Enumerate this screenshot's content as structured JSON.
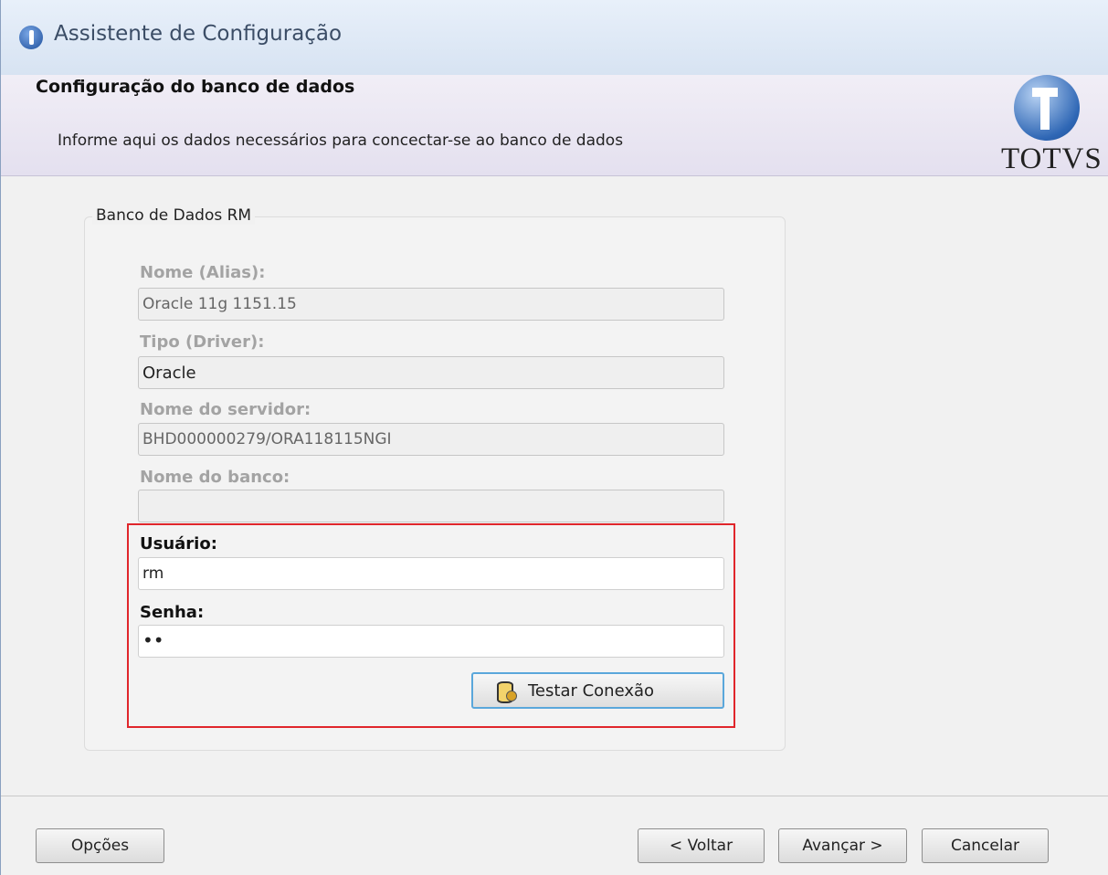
{
  "window": {
    "title": "Assistente de Configuração"
  },
  "header": {
    "title": "Configuração do banco de dados",
    "subtitle": "Informe aqui os dados necessários para concectar-se ao banco de dados",
    "logo_text": "TOTVS"
  },
  "group": {
    "legend": "Banco de Dados RM",
    "fields": {
      "alias": {
        "label": "Nome (Alias):",
        "value": "Oracle 11g 1151.15"
      },
      "driver": {
        "label": "Tipo (Driver):",
        "value": "Oracle"
      },
      "server": {
        "label": "Nome do servidor:",
        "value": "BHD000000279/ORA118115NGI"
      },
      "database": {
        "label": "Nome do banco:",
        "value": ""
      },
      "user": {
        "label": "Usuário:",
        "value": "rm"
      },
      "password": {
        "label": "Senha:",
        "value": "••"
      }
    },
    "test_button": "Testar Conexão"
  },
  "footer": {
    "options": "Opções",
    "back": "< Voltar",
    "next": "Avançar >",
    "cancel": "Cancelar"
  },
  "colors": {
    "highlight_border": "#e0262b",
    "focus_border": "#5aa7db"
  },
  "icons": {
    "app": "totvs-globe-icon",
    "test": "database-gear-icon"
  }
}
